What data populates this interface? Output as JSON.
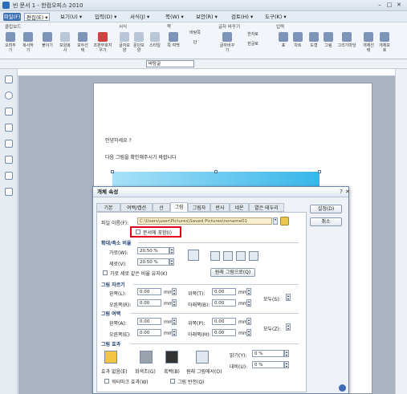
{
  "titlebar": {
    "title": "빈 문서 1 - 한컴오피스 2010"
  },
  "menubar": {
    "items": [
      "파일(F)",
      "편집(E) ▾",
      "보기(U) ▾",
      "입력(D) ▾",
      "서식(J) ▾",
      "쪽(W) ▾",
      "보안(R) ▾",
      "검토(H) ▾",
      "도구(K) ▾"
    ]
  },
  "ribbon": {
    "groups": [
      "클립보드",
      "서식",
      "쪽",
      "글자 바꾸기",
      "입력"
    ],
    "buttons": [
      "오려두기",
      "복사하기",
      "붙이기",
      "모양복사",
      "모두선택",
      "조판부호지우기",
      "글자모양",
      "문단모양",
      "스타일",
      "쪽 여백",
      "바탕쪽",
      "단",
      "글자바꾸기",
      "한자로",
      "한글로",
      "표",
      "차트",
      "도형",
      "그림",
      "그리기마당",
      "개체선택",
      "개체보호"
    ],
    "style_value": "바탕글"
  },
  "document": {
    "line1": "안녕하세요 ?",
    "line2": "다음 그림을 확인해주시기 바랍니다"
  },
  "dialog": {
    "title": "개체 속성",
    "tabs": [
      "기본",
      "여백/캡션",
      "선",
      "그림",
      "그림자",
      "반사",
      "네온",
      "옅은 테두리"
    ],
    "selected_tab": "그림",
    "set_button": "설정(D)",
    "cancel_button": "취소",
    "file_label": "파일 이름(F):",
    "file_path": "C:\\Users\\user\\Pictures\\Saved Pictures\\noname01",
    "embed_label": "문서에 포함(I)",
    "scale_section": "확대/축소 비율",
    "width_label": "가로(W):",
    "width_value": "20.50 %",
    "height_label": "세로(V):",
    "height_value": "20.50 %",
    "keep_ratio": "가로 세로 같은 비율 유지(K)",
    "original_size_btn": "원래 그림으로(Q)",
    "crop_section": "그림 자르기",
    "crop_left": "왼쪽(L):",
    "crop_right": "오른쪽(R):",
    "crop_top": "위쪽(T):",
    "crop_bottom": "아래쪽(B):",
    "crop_all": "모두(S):",
    "margin_section": "그림 여백",
    "margin_left": "왼쪽(A):",
    "margin_right": "오른쪽(E):",
    "margin_top": "위쪽(P):",
    "margin_bottom": "아래쪽(M):",
    "margin_all": "모두(Z):",
    "zero_value": "0.00",
    "unit": "mm",
    "effect_section": "그림 효과",
    "effects": [
      "효과 없음(E)",
      "회색조(G)",
      "흑백(B)",
      "원래 그림에서(O)"
    ],
    "brightness_label": "밝기(Y):",
    "brightness_value": "0 %",
    "contrast_label": "대비(U):",
    "contrast_value": "0 %",
    "watermark": "워터마크 효과(W)",
    "invert": "그림 반전(Q)"
  }
}
